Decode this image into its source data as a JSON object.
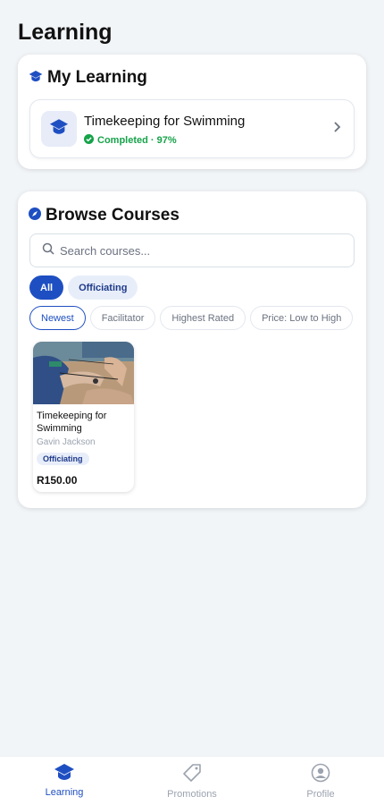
{
  "page": {
    "title": "Learning"
  },
  "my_learning": {
    "heading": "My Learning",
    "heading_icon": "graduation-cap-icon",
    "item": {
      "title": "Timekeeping for Swimming",
      "status": "Completed · 97%",
      "progress_percent": 97,
      "icon": "graduation-cap-icon",
      "status_icon": "check-circle-icon"
    }
  },
  "browse": {
    "heading": "Browse Courses",
    "heading_icon": "compass-icon",
    "search": {
      "placeholder": "Search courses...",
      "value": ""
    },
    "category_chips": [
      {
        "label": "All",
        "active": true
      },
      {
        "label": "Officiating",
        "active": false
      }
    ],
    "sort_chips": [
      {
        "label": "Newest",
        "active": true
      },
      {
        "label": "Facilitator",
        "active": false
      },
      {
        "label": "Highest Rated",
        "active": false
      },
      {
        "label": "Price: Low to High",
        "active": false
      }
    ],
    "courses": [
      {
        "title": "Timekeeping for Swimming",
        "author": "Gavin Jackson",
        "category": "Officiating",
        "price": "R150.00"
      }
    ]
  },
  "bottom_nav": [
    {
      "label": "Learning",
      "icon": "graduation-cap-icon",
      "active": true
    },
    {
      "label": "Promotions",
      "icon": "tag-icon",
      "active": false
    },
    {
      "label": "Profile",
      "icon": "user-circle-icon",
      "active": false
    }
  ],
  "colors": {
    "accent": "#1e4fc2",
    "success": "#16a34a",
    "background": "#f2f5f8"
  }
}
